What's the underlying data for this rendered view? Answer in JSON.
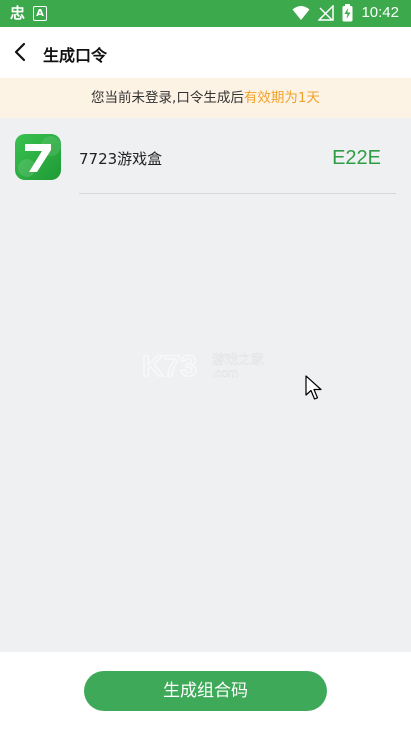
{
  "status_bar": {
    "left_icons": [
      "notification-app-icon",
      "font-a-icon"
    ],
    "left_glyph": "忠",
    "left_badge": "A",
    "right_icons": [
      "wifi-icon",
      "no-signal-icon",
      "battery-charging-icon"
    ],
    "time": "10:42",
    "color": "#3caa4c"
  },
  "header": {
    "back_icon": "back-arrow-icon",
    "title": "生成口令"
  },
  "notice": {
    "text": "您当前未登录,口令生成后",
    "highlight": "有效期为1天",
    "highlight_color": "#f0a22b",
    "background": "#fdf3e5"
  },
  "app_item": {
    "icon": "7723-app-logo-icon",
    "name": "7723游戏盒",
    "code": "E22E",
    "code_color": "#2e9d45"
  },
  "watermark": {
    "brand": "K73",
    "text": "游戏之家",
    "domain": ".com"
  },
  "footer": {
    "generate_button": "生成组合码",
    "button_color": "#3fa95a"
  }
}
